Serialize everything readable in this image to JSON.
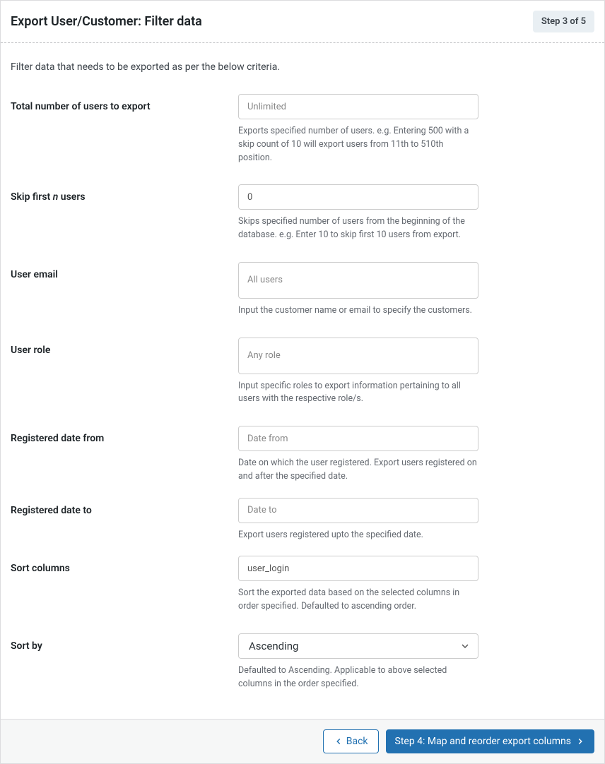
{
  "header": {
    "title": "Export User/Customer: Filter data",
    "step_badge": "Step 3 of 5"
  },
  "description": "Filter data that needs to be exported as per the below criteria.",
  "fields": {
    "total_users": {
      "label": "Total number of users to export",
      "placeholder": "Unlimited",
      "help": "Exports specified number of users. e.g. Entering 500 with a skip count of 10 will export users from 11th to 510th position."
    },
    "skip_first": {
      "label_pre": "Skip first ",
      "label_em": "n",
      "label_post": " users",
      "value": "0",
      "help": "Skips specified number of users from the beginning of the database. e.g. Enter 10 to skip first 10 users from export."
    },
    "user_email": {
      "label": "User email",
      "placeholder": "All users",
      "help": "Input the customer name or email to specify the customers."
    },
    "user_role": {
      "label": "User role",
      "placeholder": "Any role",
      "help": "Input specific roles to export information pertaining to all users with the respective role/s."
    },
    "date_from": {
      "label": "Registered date from",
      "placeholder": "Date from",
      "help": "Date on which the user registered. Export users registered on and after the specified date."
    },
    "date_to": {
      "label": "Registered date to",
      "placeholder": "Date to",
      "help": "Export users registered upto the specified date."
    },
    "sort_columns": {
      "label": "Sort columns",
      "value": "user_login",
      "help": "Sort the exported data based on the selected columns in order specified. Defaulted to ascending order."
    },
    "sort_by": {
      "label": "Sort by",
      "value": "Ascending",
      "help": "Defaulted to Ascending. Applicable to above selected columns in the order specified."
    }
  },
  "footer": {
    "back": "Back",
    "next": "Step 4: Map and reorder export columns"
  }
}
